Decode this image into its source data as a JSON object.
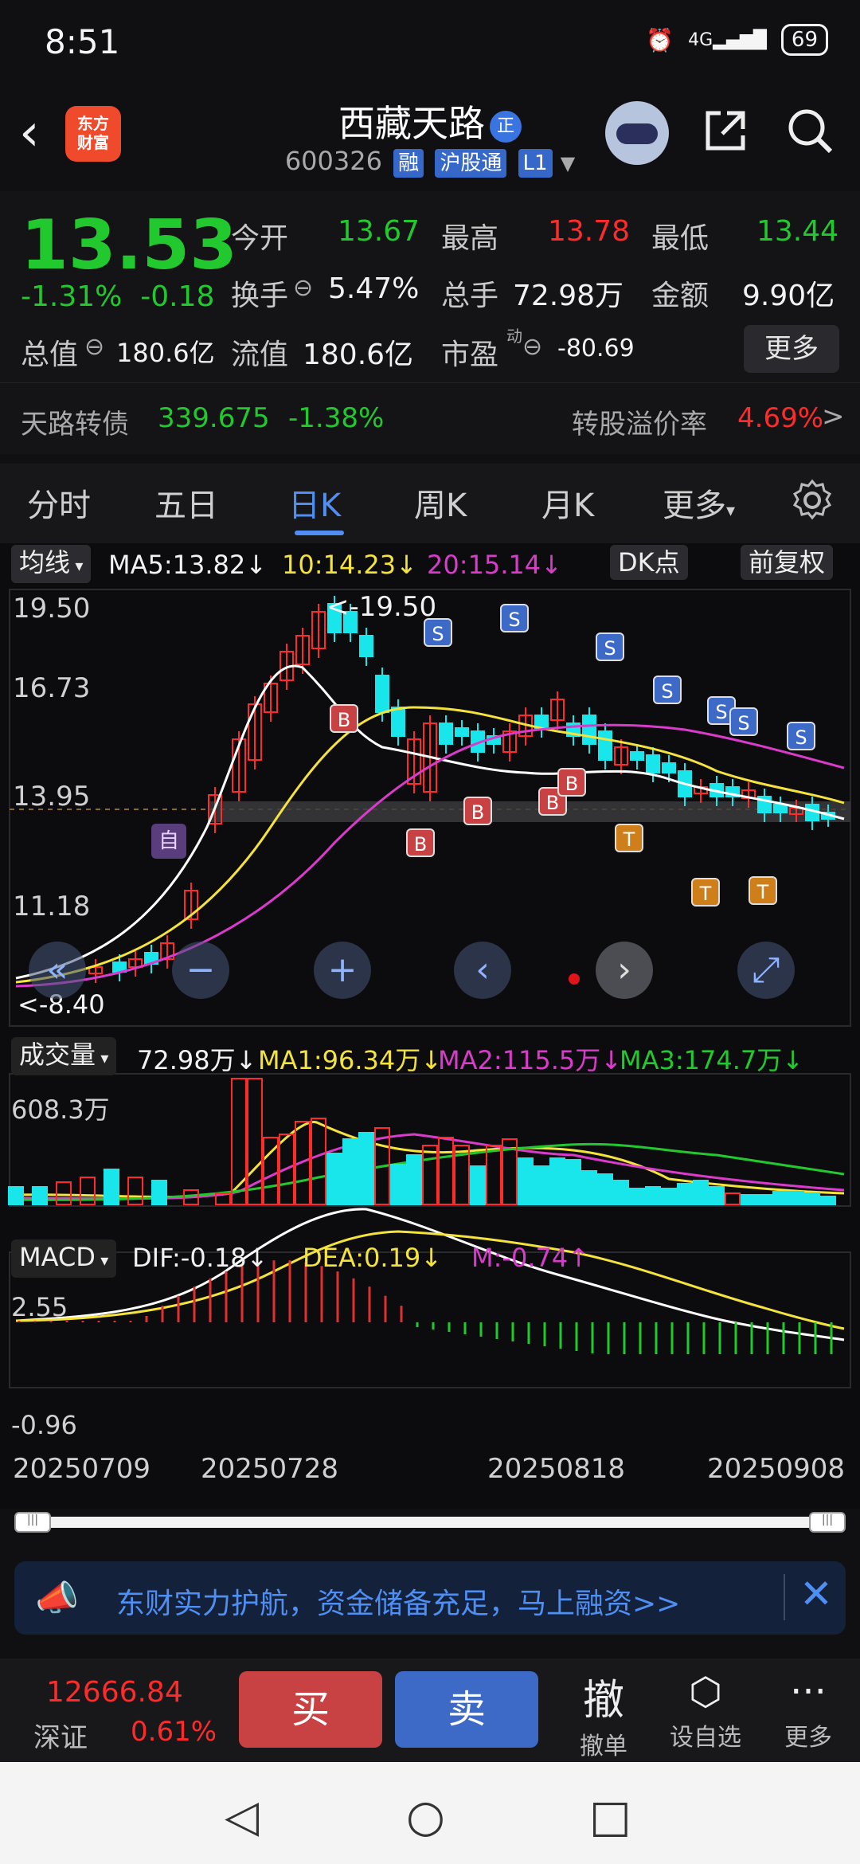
{
  "status": {
    "time": "8:51",
    "battery": "69"
  },
  "header": {
    "logo_text": "东方\n财富",
    "stock_name": "西藏天路",
    "code": "600326",
    "tags": [
      "融",
      "沪股通",
      "L1"
    ]
  },
  "quote": {
    "price": "13.53",
    "pct_change": "-1.31%",
    "abs_change": "-0.18",
    "open_label": "今开",
    "open_value": "13.67",
    "high_label": "最高",
    "high_value": "13.78",
    "low_label": "最低",
    "low_value": "13.44",
    "turnover_label": "换手",
    "turnover_value": "5.47%",
    "volume_label": "总手",
    "volume_value": "72.98万",
    "amount_label": "金额",
    "amount_value": "9.90亿",
    "mktcap_label": "总值",
    "mktcap_value": "180.6亿",
    "float_label": "流值",
    "float_value": "180.6亿",
    "pe_label": "市盈",
    "pe_sup": "动",
    "pe_value": "-80.69",
    "more_label": "更多"
  },
  "bond": {
    "name": "天路转债",
    "price": "339.675",
    "change": "-1.38%",
    "premium_label": "转股溢价率",
    "premium_value": "4.69%"
  },
  "tabs": [
    "分时",
    "五日",
    "日K",
    "周K",
    "月K",
    "更多"
  ],
  "active_tab": "日K",
  "kline": {
    "indicator_label": "均线",
    "ma5": "MA5:13.82↓",
    "ma10": "10:14.23↓",
    "ma20": "20:15.14↓",
    "dk_label": "DK点",
    "adjust_label": "前复权",
    "y_labels": [
      "19.50",
      "16.73",
      "13.95",
      "11.18"
    ],
    "high_marker": "<-19.50",
    "low_marker": "<-8.40",
    "self_marker": "自",
    "colors": {
      "ma5": "#ffffff",
      "ma10": "#f4e33c",
      "ma20": "#d93bcb",
      "up": "#ff2a2a",
      "down": "#19e6ea"
    }
  },
  "volume": {
    "label": "成交量",
    "value": "72.98万↓",
    "ma1": "MA1:96.34万↓",
    "ma2": "MA2:115.5万↓",
    "ma3": "MA3:174.7万↓",
    "y_top": "608.3万"
  },
  "macd": {
    "label": "MACD",
    "dif": "DIF:-0.18↓",
    "dea": "DEA:0.19↓",
    "m": "M:-0.74↑",
    "y_top": "2.55",
    "y_bottom": "-0.96"
  },
  "dates": [
    "20250709",
    "20250728",
    "20250818",
    "20250908"
  ],
  "promo": {
    "text": "东财实力护航，资金储备充足，马上融资>>"
  },
  "bottom": {
    "index_value": "12666.84",
    "index_name": "深证",
    "index_change": "0.61%",
    "buy": "买",
    "sell": "卖",
    "cancel_icon": "撤",
    "cancel": "撤单",
    "watch": "设自选",
    "more": "更多"
  }
}
